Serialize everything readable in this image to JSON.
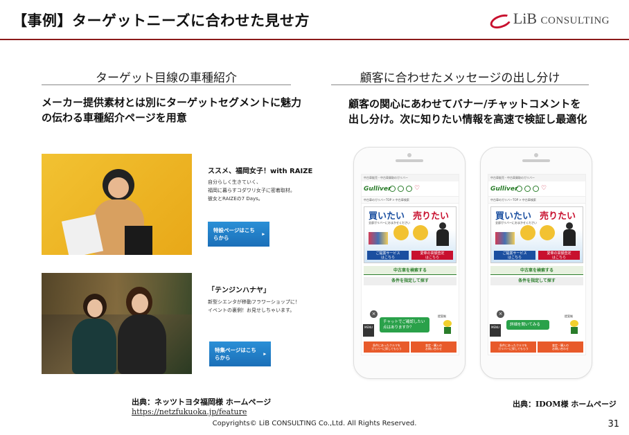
{
  "header": {
    "title": "【事例】ターゲットニーズに合わせた見せ方",
    "logo_main": "LiB",
    "logo_sub": "CONSULTING"
  },
  "left": {
    "section_title": "ターゲット目線の車種紹介",
    "subtitle_line1": "メーカー提供素材とは別にターゲットセグメントに魅力",
    "subtitle_line2": "の伝わる車種紹介ページを用意",
    "cards": [
      {
        "title": "ススメ、福岡女子！with RAIZE",
        "text_line1": "自分らしく生きていく、",
        "text_line2": "福岡に暮らすコダワリ女子に密着取材。",
        "text_line3": "彼女とRAIZEの7 Days。",
        "button_line1": "特設ページはこち",
        "button_line2": "らから",
        "button_arrow": "▸"
      },
      {
        "title": "「テンジンハナヤ」",
        "text_line1": "新型シエンタが移動フラワーショップに！",
        "text_line2": "イベントの裏側！お見せしちゃいます。",
        "text_line3": "",
        "button_line1": "特集ページはこち",
        "button_line2": "らから",
        "button_arrow": "▸"
      }
    ],
    "source_label": "出典：ネッツトヨタ福岡様 ホームページ",
    "source_url": "https://netzfukuoka.jp/feature"
  },
  "right": {
    "section_title": "顧客に合わせたメッセージの出し分け",
    "subtitle_line1": "顧客の関心にあわせてバナー/チャットコメントを",
    "subtitle_line2": "出し分け。次に知りたい情報を高速で検証し最適化",
    "phones": [
      {
        "top_bar": "中古車販売・中古車買取のガリバー",
        "logo": "Gulliver",
        "nav_labels": [
          "車を売る",
          "車を探す",
          "お店を探す",
          "お気に入り"
        ],
        "breadcrumb": "中古車のガリバーTOP  >  中古車検索",
        "banner_buy": "買いたい",
        "banner_sell": "売りたい",
        "banner_sub": "全部ガリバーにおまかせください",
        "banner_btn1_l1": "ご提案サービス",
        "banner_btn1_l2": "はこちら",
        "banner_btn2_l1": "愛車の高額査定",
        "banner_btn2_l2": "はこちら",
        "search_btn": "中古車を検索する",
        "cond_btn": "条件を指定して探す",
        "chat_line1": "チャットでご確認したい",
        "chat_line2": "点はありますか？",
        "chat_tag": "提案制",
        "menu": "MENU",
        "close": "×",
        "bottom_btn1_l1": "条件にあったクルマを",
        "bottom_btn1_l2": "ガリバーに探してもらう",
        "bottom_btn2_l1": "査定・購入の",
        "bottom_btn2_l2": "お問い合わせ"
      },
      {
        "top_bar": "中古車販売・中古車買取のガリバー",
        "logo": "Gulliver",
        "nav_labels": [
          "車を売る",
          "車を探す",
          "お店を探す",
          "お気に入り"
        ],
        "breadcrumb": "中古車のガリバーTOP  >  中古車検索",
        "banner_buy": "買いたい",
        "banner_sell": "売りたい",
        "banner_sub": "全部ガリバーにおまかせください",
        "banner_btn1_l1": "ご提案サービス",
        "banner_btn1_l2": "はこちら",
        "banner_btn2_l1": "愛車の高額査定",
        "banner_btn2_l2": "はこちら",
        "search_btn": "中古車を検索する",
        "cond_btn": "条件を指定して探す",
        "chat_line1": "詳細を聞いてみる",
        "chat_line2": "",
        "chat_tag": "提案制",
        "menu": "MENU",
        "close": "×",
        "bottom_btn1_l1": "条件にあったクルマを",
        "bottom_btn1_l2": "ガリバーに探してもらう",
        "bottom_btn2_l1": "査定・購入の",
        "bottom_btn2_l2": "お問い合わせ"
      }
    ],
    "source_label": "出典：IDOM様 ホームページ"
  },
  "footer": {
    "copyright": "Copyrights© LiB CONSULTING Co.,Ltd.  All Rights Reserved.",
    "page_number": "31"
  },
  "colors": {
    "title_rule": "#8b1a1a",
    "logo_red": "#c8102e",
    "button_blue": "#1b6fb8",
    "gulliver_green": "#2a7d2a"
  }
}
